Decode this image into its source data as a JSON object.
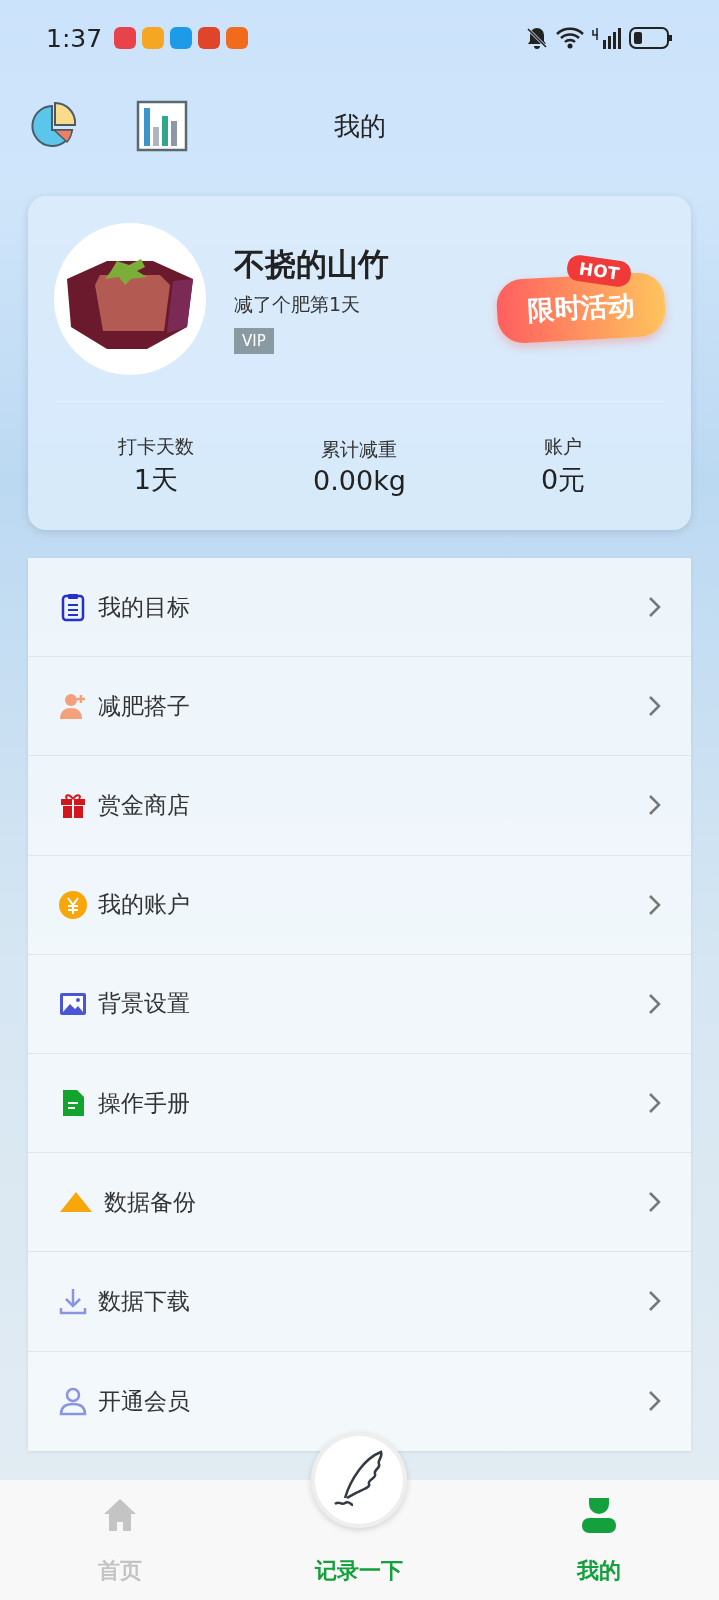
{
  "status_bar": {
    "time": "1:37"
  },
  "header": {
    "title": "我的"
  },
  "profile": {
    "name": "不挠的山竹",
    "subtitle": "减了个肥第1天",
    "badge": "VIP",
    "promo": {
      "label": "限时活动",
      "tag": "HOT"
    },
    "stats": [
      {
        "label": "打卡天数",
        "value": "1天"
      },
      {
        "label": "累计减重",
        "value": "0.00kg"
      },
      {
        "label": "账户",
        "value": "0元"
      }
    ]
  },
  "menu": [
    {
      "label": "我的目标",
      "kind": "clipboard"
    },
    {
      "label": "减肥搭子",
      "kind": "add-user"
    },
    {
      "label": "赏金商店",
      "kind": "gift"
    },
    {
      "label": "我的账户",
      "kind": "coin"
    },
    {
      "label": "背景设置",
      "kind": "image"
    },
    {
      "label": "操作手册",
      "kind": "document"
    },
    {
      "label": "数据备份",
      "kind": "triangle"
    },
    {
      "label": "数据下载",
      "kind": "download"
    },
    {
      "label": "开通会员",
      "kind": "user"
    }
  ],
  "bottom_nav": [
    {
      "label": "首页",
      "kind": "home",
      "selected": false
    },
    {
      "label": "记录一下",
      "kind": "action",
      "selected": false
    },
    {
      "label": "我的",
      "kind": "profile",
      "selected": true
    }
  ]
}
